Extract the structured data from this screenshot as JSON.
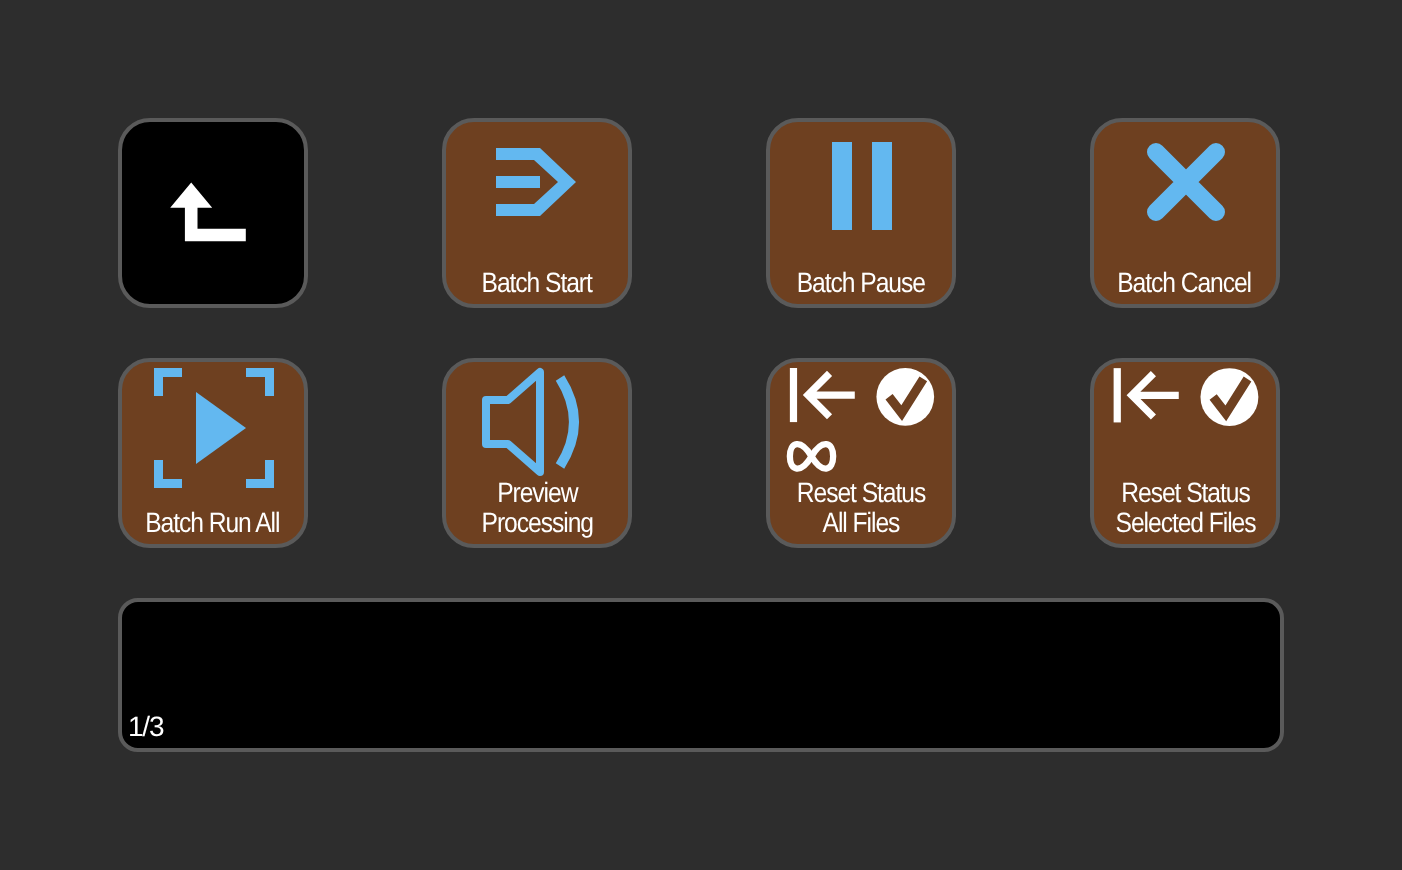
{
  "keys": [
    {
      "kind": "back"
    },
    {
      "kind": "start",
      "lines": [
        "Batch Start"
      ]
    },
    {
      "kind": "pause",
      "lines": [
        "Batch Pause"
      ]
    },
    {
      "kind": "cancel",
      "lines": [
        "Batch Cancel"
      ]
    },
    {
      "kind": "runall",
      "lines": [
        "Batch Run All"
      ]
    },
    {
      "kind": "preview",
      "lines": [
        "Preview",
        "Processing"
      ]
    },
    {
      "kind": "resetall",
      "lines": [
        "Reset Status",
        "All Files"
      ]
    },
    {
      "kind": "resetselected",
      "lines": [
        "Reset Status",
        "Selected Files"
      ]
    }
  ],
  "panel": {
    "page": "1/3"
  }
}
